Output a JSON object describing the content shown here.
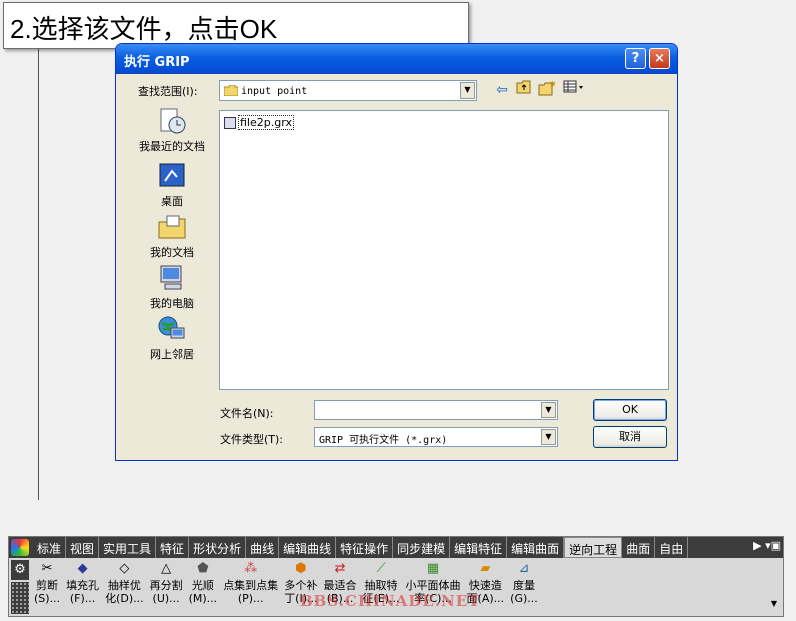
{
  "caption": "2.选择该文件，点击OK",
  "dialog": {
    "title": "执行 GRIP",
    "help_label": "?",
    "close_label": "×",
    "lookin_label": "查找范围(I):",
    "lookin_value": "input point",
    "places": [
      {
        "label": "我最近的文档",
        "icon": "recent-documents-icon"
      },
      {
        "label": "桌面",
        "icon": "desktop-icon"
      },
      {
        "label": "我的文档",
        "icon": "my-documents-icon"
      },
      {
        "label": "我的电脑",
        "icon": "my-computer-icon"
      },
      {
        "label": "网上邻居",
        "icon": "network-places-icon"
      }
    ],
    "files": [
      {
        "name": "file2p.grx"
      }
    ],
    "filename_label": "文件名(N):",
    "filename_value": "",
    "filetype_label": "文件类型(T):",
    "filetype_value": "GRIP 可执行文件 (*.grx)",
    "ok_label": "OK",
    "cancel_label": "取消"
  },
  "ribbon": {
    "tabs": [
      "标准",
      "视图",
      "实用工具",
      "特征",
      "形状分析",
      "曲线",
      "编辑曲线",
      "特征操作",
      "同步建模",
      "编辑特征",
      "编辑曲面",
      "逆向工程",
      "曲面",
      "自由"
    ],
    "active_tab": "逆向工程",
    "commands": [
      {
        "line1": "剪断",
        "line2": "(S)..."
      },
      {
        "line1": "填充孔",
        "line2": "(F)..."
      },
      {
        "line1": "抽样优",
        "line2": "化(D)..."
      },
      {
        "line1": "再分割",
        "line2": "(U)..."
      },
      {
        "line1": "光顺",
        "line2": "(M)..."
      },
      {
        "line1": "点集到点集",
        "line2": "(P)..."
      },
      {
        "line1": "多个补",
        "line2": "丁(I)..."
      },
      {
        "line1": "最适合",
        "line2": "(B)..."
      },
      {
        "line1": "抽取特",
        "line2": "征(E)..."
      },
      {
        "line1": "小平面体曲",
        "line2": "率(C)..."
      },
      {
        "line1": "快速造",
        "line2": "面(A)..."
      },
      {
        "line1": "度量",
        "line2": "(G)..."
      }
    ]
  },
  "watermark": "BBS.CHINADE.NET"
}
